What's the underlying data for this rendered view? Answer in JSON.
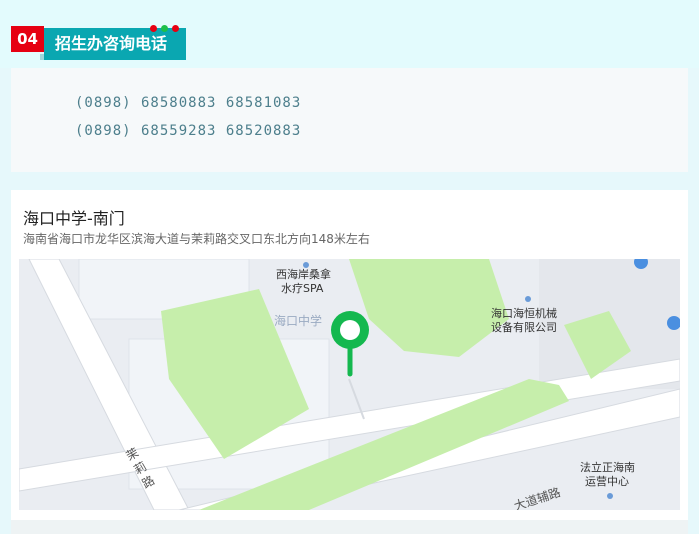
{
  "section": {
    "number": "04",
    "title": "招生办咨询电话",
    "colors": {
      "accent": "#0aa7b1",
      "badge": "#e60012"
    }
  },
  "phones": {
    "line1": "(0898) 68580883  68581083",
    "line2": "(0898) 68559283  68520883"
  },
  "location": {
    "name": "海口中学-南门",
    "address": "海南省海口市龙华区滨海大道与茉莉路交叉口东北方向148米左右"
  },
  "map": {
    "pin_icon": "map-pin-icon",
    "poi_spa_line1": "西海岸桑拿",
    "poi_spa_line2": "水疗SPA",
    "poi_school": "海口中学",
    "poi_machine_line1": "海口海恒机械",
    "poi_machine_line2": "设备有限公司",
    "road_moli": [
      "茉",
      "莉",
      "路"
    ],
    "road_fudao": "大道辅路",
    "poi_legal_line1": "法立正海南",
    "poi_legal_line2": "运营中心"
  }
}
